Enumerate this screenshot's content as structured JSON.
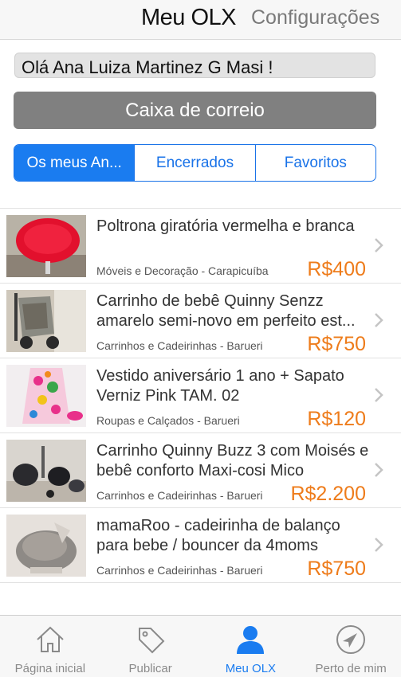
{
  "header": {
    "title": "Meu OLX",
    "settings": "Configurações"
  },
  "greeting": "Olá Ana Luiza Martinez G Masi !",
  "mailbox": "Caixa de correio",
  "segments": [
    {
      "label": "Os meus An...",
      "active": true
    },
    {
      "label": "Encerrados",
      "active": false
    },
    {
      "label": "Favoritos",
      "active": false
    }
  ],
  "ads": [
    {
      "title": "Poltrona giratória vermelha e branca",
      "category": "Móveis e Decoração - Carapicuíba",
      "price": "R$400",
      "thumb": "red-chair"
    },
    {
      "title": "Carrinho de bebê Quinny Senzz amarelo semi-novo em perfeito est...",
      "category": "Carrinhos e Cadeirinhas - Barueri",
      "price": "R$750",
      "thumb": "stroller"
    },
    {
      "title": "Vestido aniversário 1 ano + Sapato Verniz Pink TAM. 02",
      "category": "Roupas e Calçados - Barueri",
      "price": "R$120",
      "thumb": "dress"
    },
    {
      "title": "Carrinho Quinny Buzz 3 com Moisés e bebê conforto Maxi-cosi Mico",
      "category": "Carrinhos e Cadeirinhas - Barueri",
      "price": "R$2.200",
      "thumb": "stroller-set"
    },
    {
      "title": "mamaRoo - cadeirinha de balanço para bebe / bouncer da 4moms",
      "category": "Carrinhos e Cadeirinhas - Barueri",
      "price": "R$750",
      "thumb": "bouncer"
    }
  ],
  "tabs": [
    {
      "label": "Página inicial",
      "icon": "home-icon",
      "active": false
    },
    {
      "label": "Publicar",
      "icon": "tag-icon",
      "active": false
    },
    {
      "label": "Meu OLX",
      "icon": "person-icon",
      "active": true
    },
    {
      "label": "Perto de mim",
      "icon": "location-arrow-icon",
      "active": false
    }
  ],
  "colors": {
    "accent": "#1a7cf0",
    "price": "#ee7c1b",
    "mailbox": "#808080"
  }
}
